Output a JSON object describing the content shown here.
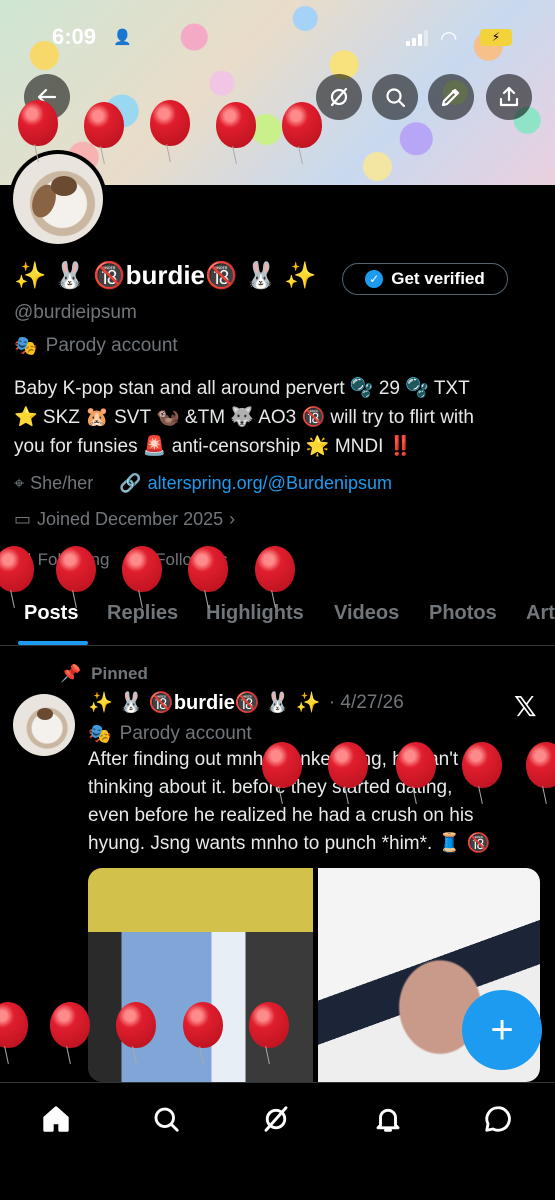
{
  "status_bar": {
    "time": "6:09",
    "battery_icon": "charging-battery-icon"
  },
  "header": {
    "back_icon": "arrow-left-icon",
    "actions": [
      "grok-icon",
      "search-icon",
      "edit-icon",
      "share-icon"
    ]
  },
  "profile": {
    "display_name": "✨ 🐰 🔞burdie🔞 🐰 ✨",
    "verify_button": "Get verified",
    "handle": "@burdieipsum",
    "parody_label": "Parody account",
    "bio_line1": "Baby K-pop stan and all around pervert 🫧 29 🫧 TXT",
    "bio_line2": "⭐ SKZ 🐹 SVT 🦦 &TM 🐺 AO3 🔞 will try to flirt with",
    "bio_line3": "you for funsies 🚨 anti-censorship 🌟 MNDI ‼️",
    "pronouns": "She/her",
    "link": "alterspring.org/@Burdenipsum",
    "joined": "Joined December 2025",
    "following_count": "91",
    "following_label": "Following",
    "followers_count": "22",
    "followers_label": "Followers"
  },
  "tabs": [
    "Posts",
    "Replies",
    "Highlights",
    "Videos",
    "Photos",
    "Art"
  ],
  "active_tab": "Posts",
  "post": {
    "pinned_label": "Pinned",
    "author": "✨ 🐰 🔞burdie🔞 🐰 ✨",
    "date": "· 4/27/26",
    "parody_label": "Parody account",
    "text_line1": "After finding out mnho bonked jsng, he can't stop",
    "text_line2": "thinking about it. before they started dating,",
    "text_line3": "even before he realized he had a crush on his",
    "text_line4": "hyung. Jsng wants mnho to punch *him*. 🧵 🔞"
  },
  "fab_label": "+",
  "bottom_nav": [
    "home-icon",
    "search-icon",
    "grok-icon",
    "notifications-icon",
    "messages-icon"
  ],
  "colors": {
    "accent": "#1d9bf0",
    "background": "#000000",
    "muted": "#71767b",
    "balloon": "#e01e2e"
  }
}
